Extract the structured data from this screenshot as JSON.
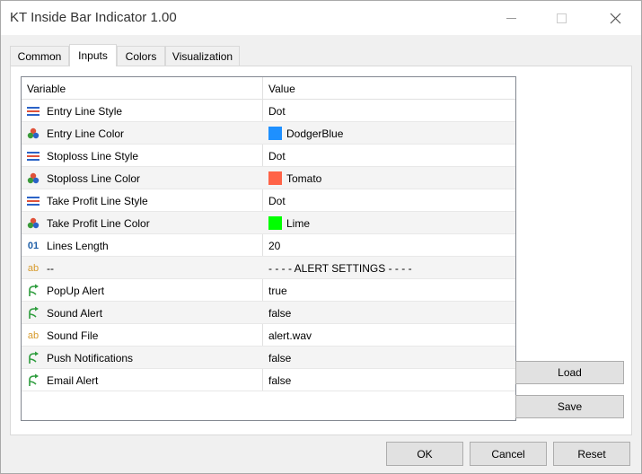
{
  "window": {
    "title": "KT Inside Bar Indicator 1.00"
  },
  "tabs": [
    {
      "label": "Common"
    },
    {
      "label": "Inputs"
    },
    {
      "label": "Colors"
    },
    {
      "label": "Visualization"
    }
  ],
  "active_tab": "Inputs",
  "grid": {
    "headers": {
      "variable": "Variable",
      "value": "Value"
    },
    "rows": [
      {
        "variable": "Entry Line Style",
        "value": "Dot",
        "icon": "line-style-icon"
      },
      {
        "variable": "Entry Line Color",
        "value": "DodgerBlue",
        "icon": "color-palette-icon",
        "color": "#1e90ff"
      },
      {
        "variable": "Stoploss Line Style",
        "value": "Dot",
        "icon": "line-style-icon"
      },
      {
        "variable": "Stoploss Line Color",
        "value": "Tomato",
        "icon": "color-palette-icon",
        "color": "#ff6347"
      },
      {
        "variable": "Take Profit Line Style",
        "value": "Dot",
        "icon": "line-style-icon"
      },
      {
        "variable": "Take Profit Line Color",
        "value": "Lime",
        "icon": "color-palette-icon",
        "color": "#00ff00"
      },
      {
        "variable": "Lines Length",
        "value": "20",
        "icon": "integer-icon",
        "icon_text": "01"
      },
      {
        "variable": "--",
        "value": "- - - - ALERT SETTINGS - - - -",
        "icon": "string-icon",
        "icon_text": "ab"
      },
      {
        "variable": "PopUp Alert",
        "value": "true",
        "icon": "boolean-icon"
      },
      {
        "variable": "Sound Alert",
        "value": "false",
        "icon": "boolean-icon"
      },
      {
        "variable": "Sound File",
        "value": "alert.wav",
        "icon": "string-icon",
        "icon_text": "ab"
      },
      {
        "variable": "Push Notifications",
        "value": "false",
        "icon": "boolean-icon"
      },
      {
        "variable": "Email Alert",
        "value": "false",
        "icon": "boolean-icon"
      }
    ]
  },
  "side_buttons": {
    "load": "Load",
    "save": "Save"
  },
  "footer_buttons": {
    "ok": "OK",
    "cancel": "Cancel",
    "reset": "Reset"
  }
}
